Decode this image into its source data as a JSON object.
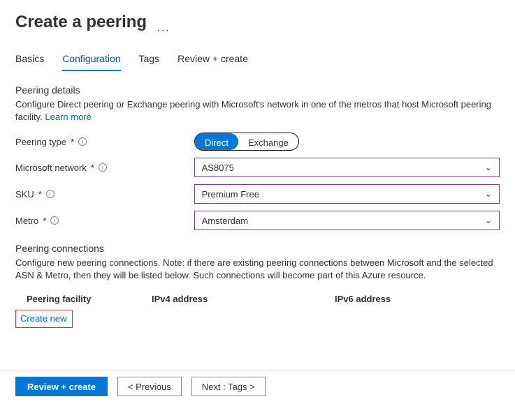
{
  "header": {
    "title": "Create a peering"
  },
  "tabs": {
    "items": [
      "Basics",
      "Configuration",
      "Tags",
      "Review + create"
    ],
    "active_index": 1
  },
  "details": {
    "section_title": "Peering details",
    "description": "Configure Direct peering or Exchange peering with Microsoft's network in one of the metros that host Microsoft peering facility. ",
    "learn_more": "Learn more"
  },
  "form": {
    "peering_type": {
      "label": "Peering type",
      "options": [
        "Direct",
        "Exchange"
      ],
      "selected": "Direct"
    },
    "microsoft_network": {
      "label": "Microsoft network",
      "value": "AS8075"
    },
    "sku": {
      "label": "SKU",
      "value": "Premium Free"
    },
    "metro": {
      "label": "Metro",
      "value": "Amsterdam"
    }
  },
  "connections": {
    "section_title": "Peering connections",
    "description": "Configure new peering connections. Note: if there are existing peering connections between Microsoft and the selected ASN & Metro, then they will be listed below. Such connections will become part of this Azure resource.",
    "columns": [
      "Peering facility",
      "IPv4 address",
      "IPv6 address"
    ],
    "create_new": "Create new"
  },
  "footer": {
    "review": "Review + create",
    "previous": "< Previous",
    "next": "Next : Tags >"
  },
  "glyphs": {
    "info": "i",
    "chevron": "⌄",
    "dots": "···"
  }
}
